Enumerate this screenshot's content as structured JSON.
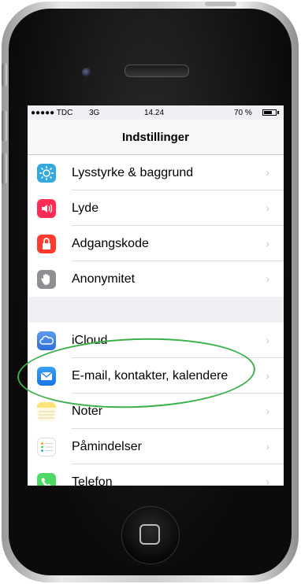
{
  "status_bar": {
    "carrier": "●●●●● TDC",
    "network": "3G",
    "time": "14.24",
    "battery": "70 %",
    "battery_level": 0.7
  },
  "navbar": {
    "title": "Indstillinger"
  },
  "group1": [
    {
      "label": "Lysstyrke & baggrund",
      "icon": "brightness-icon",
      "color": "#34aadc"
    },
    {
      "label": "Lyde",
      "icon": "speaker-icon",
      "color": "#ff2d55"
    },
    {
      "label": "Adgangskode",
      "icon": "lock-icon",
      "color": "#ff3b30"
    },
    {
      "label": "Anonymitet",
      "icon": "hand-icon",
      "color": "#8e8e93"
    }
  ],
  "group2": [
    {
      "label": "iCloud",
      "icon": "cloud-icon",
      "color": "#3e7ce0"
    },
    {
      "label": "E-mail, kontakter, kalendere",
      "icon": "mail-icon",
      "color": "#1d8bf1"
    },
    {
      "label": "Noter",
      "icon": "notes-icon",
      "color": "#ffd34e"
    },
    {
      "label": "Påmindelser",
      "icon": "reminders-icon",
      "color": "#ffffff"
    },
    {
      "label": "Telefon",
      "icon": "phone-icon",
      "color": "#4cd964"
    }
  ],
  "chevron": "›",
  "highlight_color": "#3bb04a"
}
